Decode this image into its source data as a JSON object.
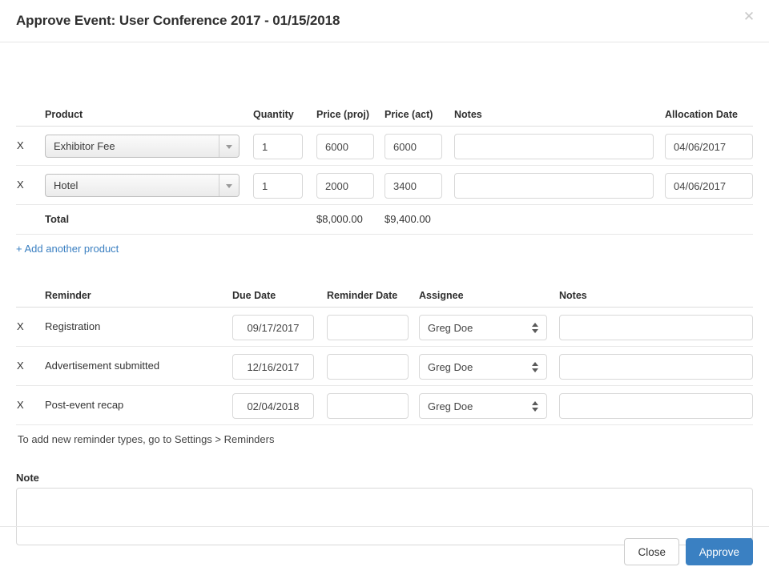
{
  "header": {
    "title": "Approve Event: User Conference 2017 - 01/15/2018",
    "close_icon": "close-icon",
    "close_glyph": "✕"
  },
  "products": {
    "columns": {
      "product": "Product",
      "quantity": "Quantity",
      "price_proj": "Price (proj)",
      "price_act": "Price (act)",
      "notes": "Notes",
      "allocation_date": "Allocation Date"
    },
    "remove_label": "X",
    "rows": [
      {
        "product": "Exhibitor Fee",
        "quantity": "1",
        "price_proj": "6000",
        "price_act": "6000",
        "notes": "",
        "allocation_date": "04/06/2017"
      },
      {
        "product": "Hotel",
        "quantity": "1",
        "price_proj": "2000",
        "price_act": "3400",
        "notes": "",
        "allocation_date": "04/06/2017"
      }
    ],
    "total": {
      "label": "Total",
      "price_proj": "$8,000.00",
      "price_act": "$9,400.00"
    },
    "add_link": "+ Add another product"
  },
  "reminders": {
    "columns": {
      "reminder": "Reminder",
      "due_date": "Due Date",
      "reminder_date": "Reminder Date",
      "assignee": "Assignee",
      "notes": "Notes"
    },
    "remove_label": "X",
    "rows": [
      {
        "reminder": "Registration",
        "due_date": "09/17/2017",
        "reminder_date": "",
        "assignee": "Greg Doe",
        "notes": ""
      },
      {
        "reminder": "Advertisement submitted",
        "due_date": "12/16/2017",
        "reminder_date": "",
        "assignee": "Greg Doe",
        "notes": ""
      },
      {
        "reminder": "Post-event recap",
        "due_date": "02/04/2018",
        "reminder_date": "",
        "assignee": "Greg Doe",
        "notes": ""
      }
    ],
    "helper_text": "To add new reminder types, go to Settings > Reminders"
  },
  "note": {
    "label": "Note",
    "value": "",
    "placeholder": ""
  },
  "footer": {
    "close_label": "Close",
    "approve_label": "Approve"
  },
  "colors": {
    "primary": "#3a80c2",
    "link": "#3a7fc1",
    "border": "#e6e6e6"
  }
}
